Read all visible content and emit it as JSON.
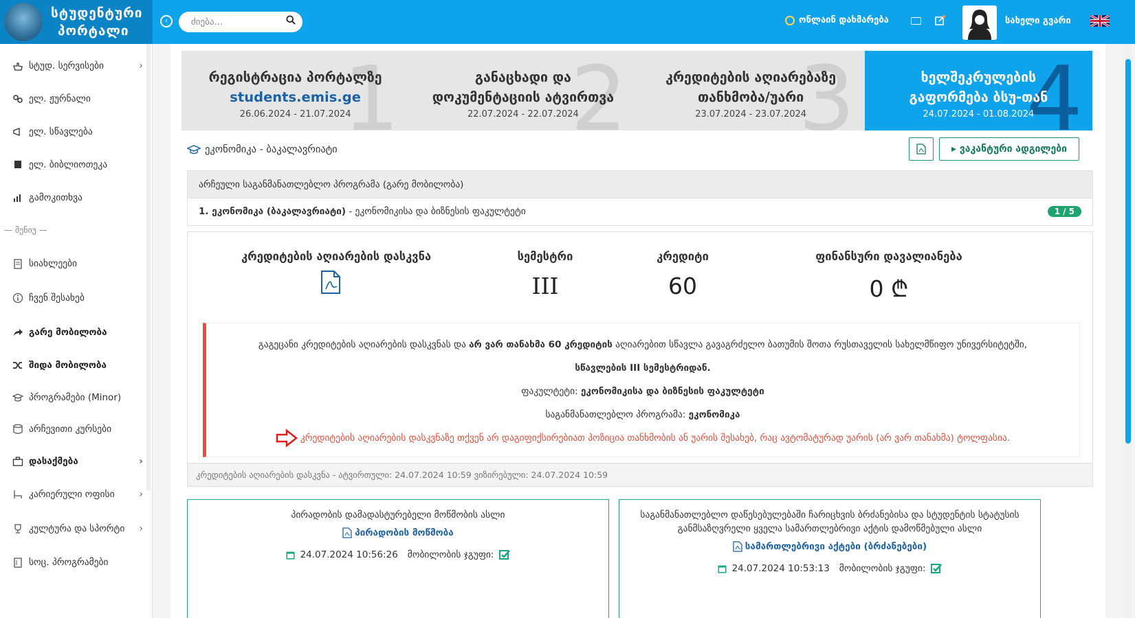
{
  "header": {
    "logo_line1": "სტუდენტური",
    "logo_line2": "პორტალი",
    "search_placeholder": "ძიება...",
    "help_label": "ონლაინ დახმარება",
    "username": "სახელი გვარი"
  },
  "sidebar": {
    "items": [
      {
        "label": "სტუდ. სერვისები",
        "icon": "hand-pointer-icon",
        "chevron": true
      },
      {
        "label": "ელ. ჟურნალი",
        "icon": "link-icon",
        "chevron": false
      },
      {
        "label": "ელ. სწავლება",
        "icon": "megaphone-icon",
        "chevron": false
      },
      {
        "label": "ელ. ბიბლიოთეკა",
        "icon": "book-icon",
        "chevron": false
      },
      {
        "label": "გამოკითხვა",
        "icon": "bar-chart-icon",
        "chevron": false
      }
    ],
    "section_label": "— მენიუ —",
    "menu": [
      {
        "label": "სიახლეები",
        "icon": "clipboard-icon",
        "chevron": false
      },
      {
        "label": "ჩვენ შესახებ",
        "icon": "info-icon",
        "chevron": false
      },
      {
        "label": "გარე მობილობა",
        "icon": "share-icon",
        "chevron": false
      },
      {
        "label": "შიდა მობილობა",
        "icon": "shuffle-icon",
        "chevron": false
      },
      {
        "label": "პროგრამები (Minor)",
        "icon": "graduation-cap-icon",
        "chevron": false
      },
      {
        "label": "არჩევითი კურსები",
        "icon": "database-icon",
        "chevron": false
      },
      {
        "label": "დასაქმება",
        "icon": "briefcase-icon",
        "chevron": true
      },
      {
        "label": "კარიერული ოფისი",
        "icon": "chair-icon",
        "chevron": true
      },
      {
        "label": "კულტურა და სპორტი",
        "icon": "trophy-icon",
        "chevron": true
      },
      {
        "label": "სოც. პროგრამები",
        "icon": "clipboard-icon",
        "chevron": false
      }
    ]
  },
  "steps": [
    {
      "num": "1",
      "title": "რეგისტრაცია პორტალზე",
      "link": "students.emis.ge",
      "dates": "26.06.2024 - 21.07.2024",
      "active": false
    },
    {
      "num": "2",
      "title": "განაცხადი და დოკუმენტაციის ატვირთვა",
      "link": "",
      "dates": "22.07.2024 - 22.07.2024",
      "active": false
    },
    {
      "num": "3",
      "title": "კრედიტების აღიარებაზე თანხმობა/უარი",
      "link": "",
      "dates": "23.07.2024 - 23.07.2024",
      "active": false
    },
    {
      "num": "4",
      "title": "ხელშეკრულების გაფორმება ბსუ-თან",
      "link": "",
      "dates": "24.07.2024 - 01.08.2024",
      "active": true
    }
  ],
  "program": {
    "name": "ეკონომიკა - ბაკალავრიატი",
    "vacancies_button": "ვაკანტური ადგილები"
  },
  "selected": {
    "header": "არჩეული საგანმანათლებლო პროგრამა (გარე მობილობა)",
    "row_bold": "1. ეკონომიკა (ბაკალავრიატი)",
    "row_rest": " - ეკონომიკისა და ბიზნესის ფაკულტეტი",
    "badge": "1 / 5"
  },
  "result": {
    "col1_label": "კრედიტების აღიარების დასკვნა",
    "col2_label": "სემესტრი",
    "col2_value": "III",
    "col3_label": "კრედიტი",
    "col3_value": "60",
    "col4_label": "ფინანსური დავალიანება",
    "col4_value": "0 ₾",
    "alert_line1_a": "გაგეცანი კრედიტების აღიარების დასკვნას და ",
    "alert_line1_b": "არ ვარ თანახმა 60 კრედიტის",
    "alert_line1_c": " აღიარებით სწავლა გავაგრძელო ბათუმის შოთა რუსთაველის სახელმწიფო უნივერსიტეტში,",
    "alert_line2": "სწავლების III სემესტრიდან.",
    "alert_faculty_label": "ფაკულტეტი: ",
    "alert_faculty_value": "ეკონომიკისა და ბიზნესის ფაკულტეტი",
    "alert_program_label": "საგანმანათლებლო პროგრამა: ",
    "alert_program_value": "ეკონომიკა",
    "alert_warning": "კრედიტების აღიარების დასკვნაზე თქვენ არ დაგიფიქსირებიათ პოზიცია თანხმობის ან უარის შესახებ, რაც ავტომატურად უარის (არ ვარ თანახმა) ტოლფასია.",
    "footer": "კრედიტების აღიარების დასკვნა - ატვირთული: 24.07.2024 10:59 ვიზირებული: 24.07.2024 10:59"
  },
  "cards": [
    {
      "title": "პირადობის დამადასტურებელი მოწმობის ასლი",
      "link": "პირადობის მოწმობა",
      "date": "24.07.2024 10:56:26",
      "group_label": "მობილობის ჯგუფი:"
    },
    {
      "title": "საგანმანათლებლო დაწესებულებაში ჩარიცხვის ბრძანებისა და სტუდენტის სტატუსის განმსაზღვრელი ყველა სამართლებრივი აქტის დამოწმებული ასლი",
      "link": "სამართლებრივი აქტები (ბრძანებები)",
      "date": "24.07.2024 10:53:13",
      "group_label": "მობილობის ჯგუფი:"
    }
  ]
}
